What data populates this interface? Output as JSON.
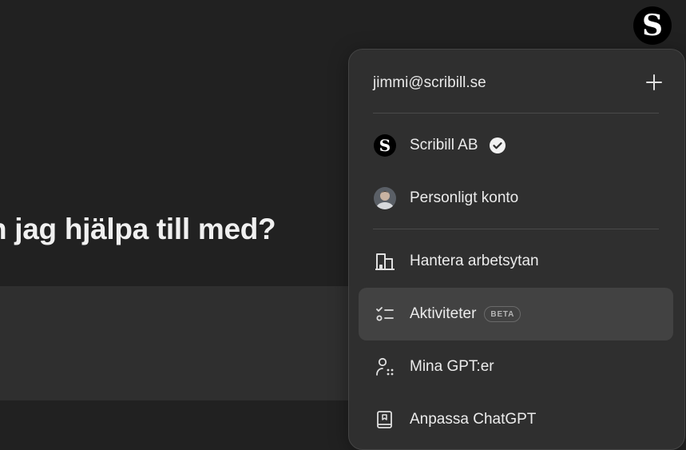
{
  "main": {
    "heading": "n jag hjälpa till med?"
  },
  "top_avatar": {
    "letter": "S"
  },
  "account_menu": {
    "email": "jimmi@scribill.se",
    "workspaces": [
      {
        "label": "Scribill AB",
        "icon": "scribill-logo-icon",
        "verified": true,
        "logo_letter": "S"
      },
      {
        "label": "Personligt konto",
        "icon": "user-photo-icon",
        "verified": false
      }
    ],
    "actions": [
      {
        "label": "Hantera arbetsytan",
        "icon": "building-icon"
      },
      {
        "label": "Aktiviteter",
        "icon": "tasks-icon",
        "badge": "BETA",
        "highlighted": true
      },
      {
        "label": "Mina GPT:er",
        "icon": "gpts-icon"
      },
      {
        "label": "Anpassa ChatGPT",
        "icon": "customize-book-icon"
      }
    ]
  },
  "colors": {
    "background": "#212121",
    "menu_background": "#2f2f2f",
    "highlight": "#424242",
    "text": "#ececec"
  }
}
